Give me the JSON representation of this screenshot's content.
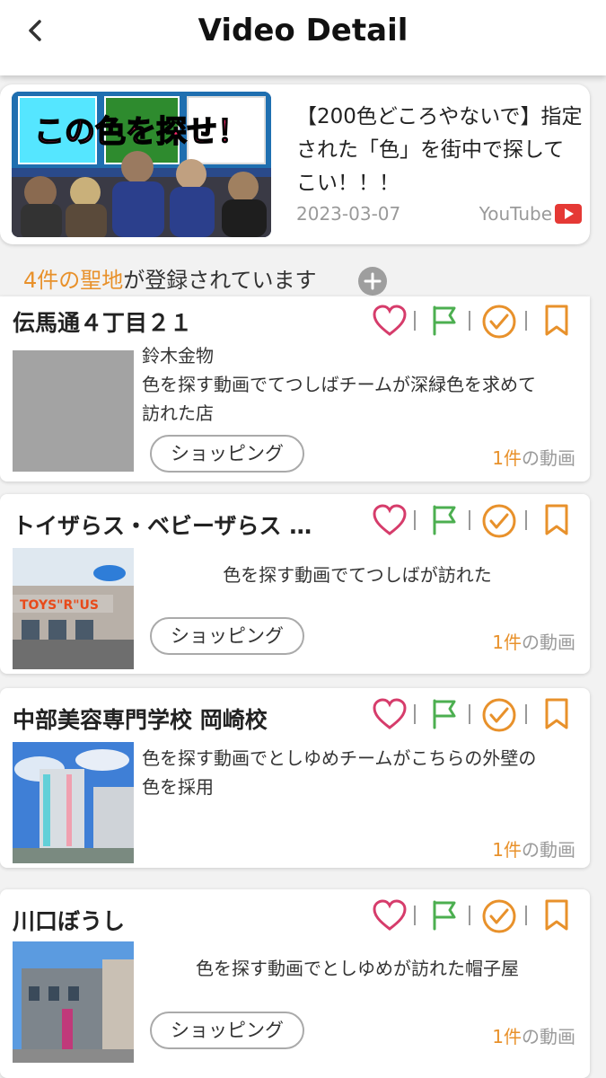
{
  "header": {
    "title": "Video Detail",
    "back_icon": "chevron-left-icon"
  },
  "video": {
    "thumbnail_text": "この色を探せ！",
    "title": "【200色どころやないで】指定された「色」を街中で探してこい！！！",
    "date": "2023-03-07",
    "source": "YouTube"
  },
  "spots_summary": {
    "count_text": "4件の聖地",
    "suffix": "が登録されています"
  },
  "spots": [
    {
      "name": "伝馬通４丁目２１",
      "desc_lines": [
        "鈴木金物",
        "色を探す動画でてつしばチームが深緑色を求めて",
        "訪れた店"
      ],
      "tag": "ショッピング",
      "video_count_num": "1件",
      "video_count_suffix": "の動画"
    },
    {
      "name": "トイザらス・ベビーザらス …",
      "desc_lines": [
        "色を探す動画でてつしばが訪れた"
      ],
      "tag": "ショッピング",
      "video_count_num": "1件",
      "video_count_suffix": "の動画"
    },
    {
      "name": "中部美容専門学校 岡崎校",
      "desc_lines": [
        "色を探す動画でとしゆめチームがこちらの外壁の",
        "色を採用"
      ],
      "tag": "",
      "video_count_num": "1件",
      "video_count_suffix": "の動画"
    },
    {
      "name": "川口ぼうし",
      "desc_lines": [
        "色を探す動画でとしゆめが訪れた帽子屋"
      ],
      "tag": "ショッピング",
      "video_count_num": "1件",
      "video_count_suffix": "の動画"
    }
  ],
  "colors": {
    "accent_orange": "#e8912b",
    "heart_pink": "#d63c6b",
    "flag_green": "#4caf50",
    "youtube_red": "#e53935"
  },
  "action_icons": [
    "heart-icon",
    "flag-icon",
    "check-circle-icon",
    "bookmark-icon"
  ]
}
